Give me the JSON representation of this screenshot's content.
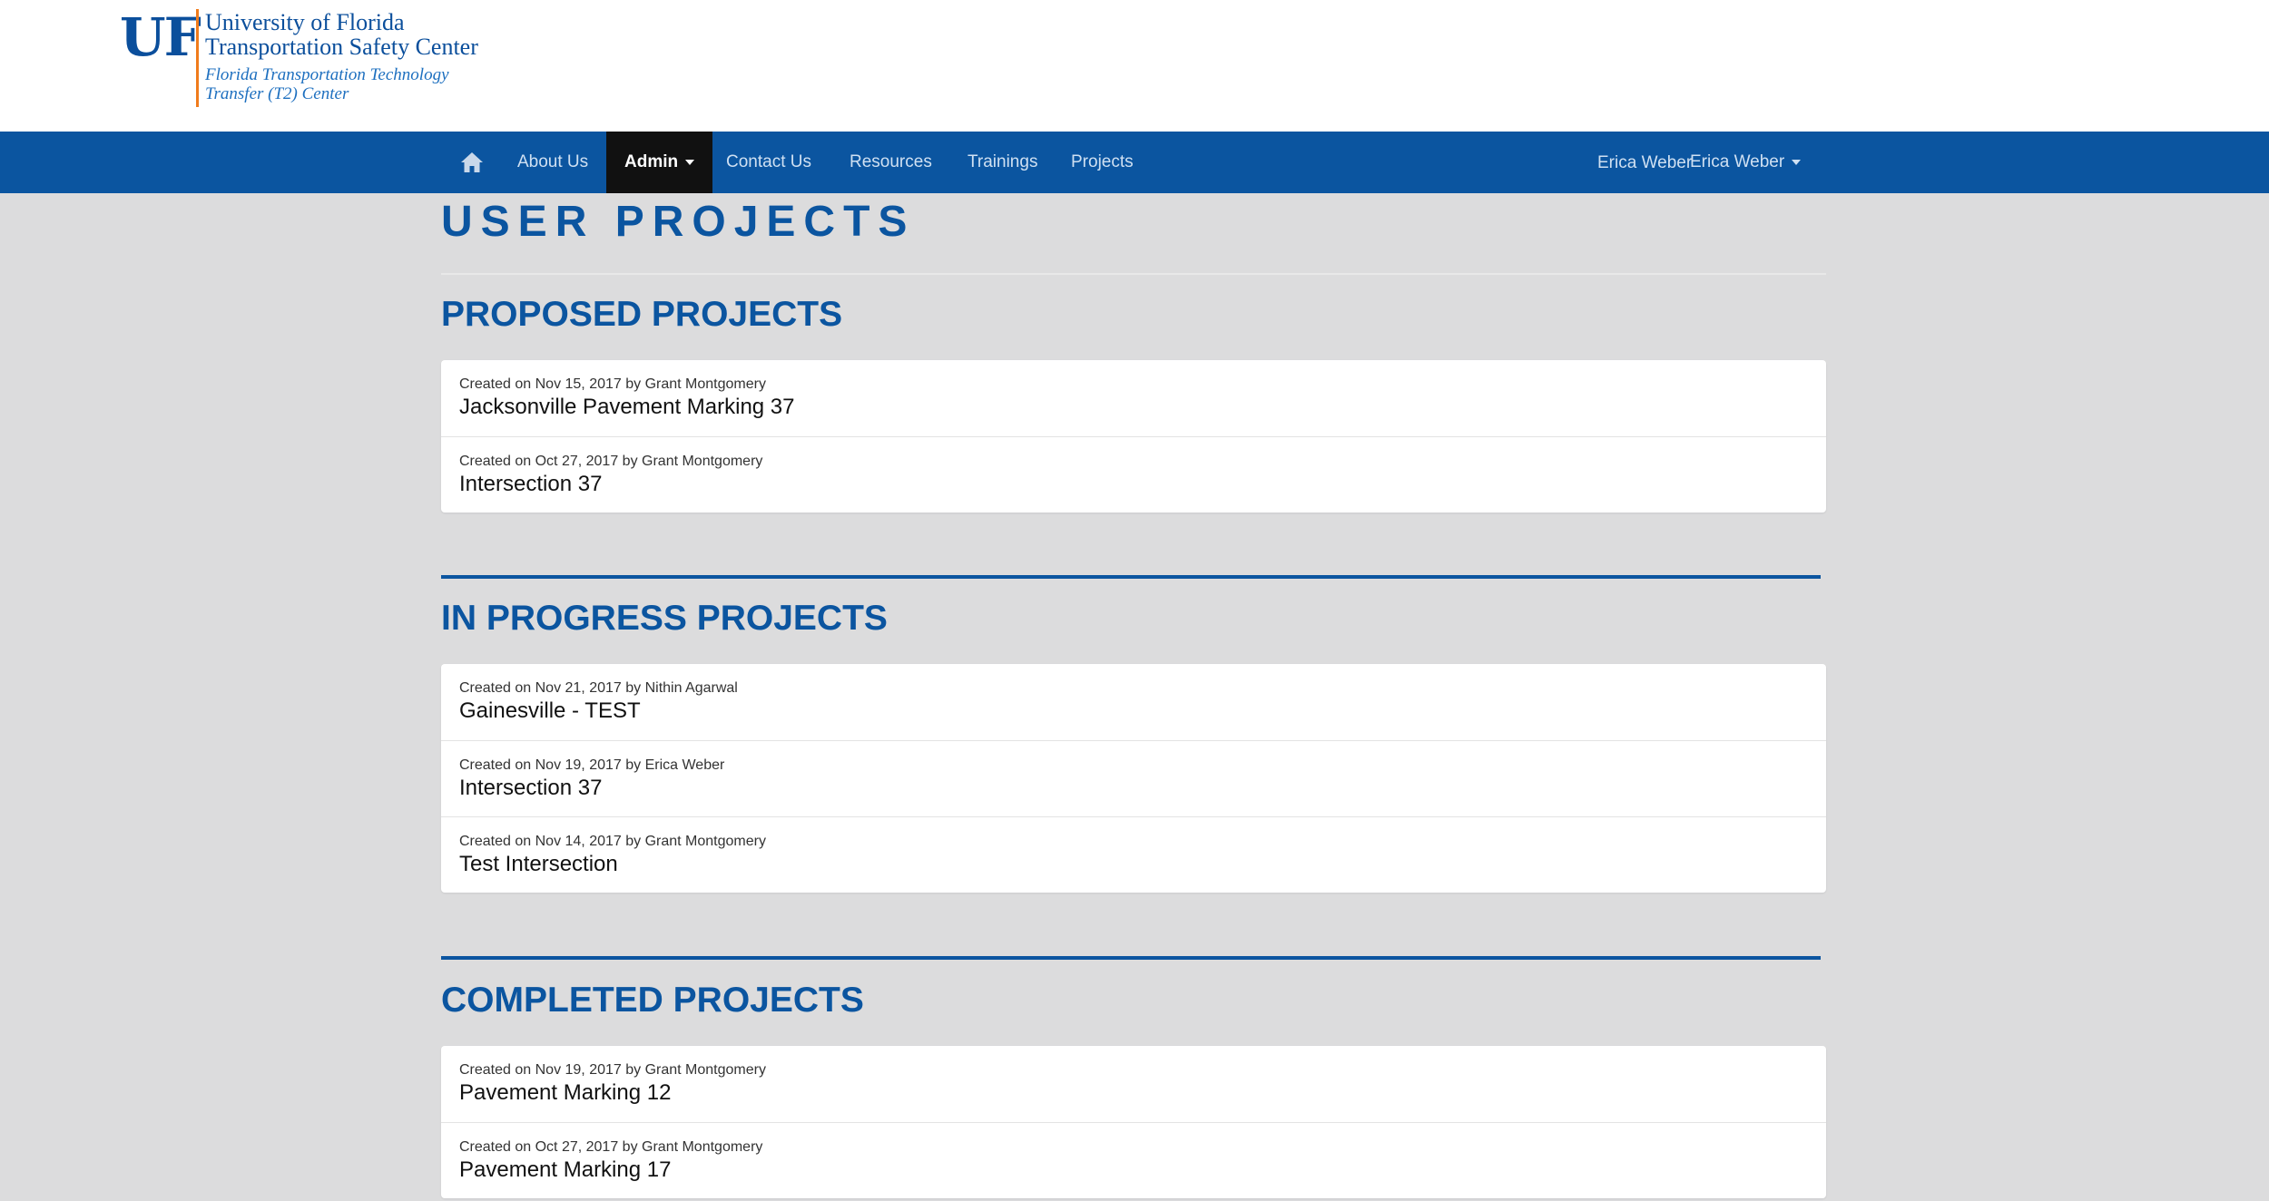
{
  "logo": {
    "mark": "UF",
    "line1": "University of Florida",
    "line2": "Transportation Safety Center",
    "line3": "Florida Transportation Technology",
    "line4": "Transfer (T2) Center",
    "brand_color": "#0b4f9c",
    "accent_color": "#f07c1c"
  },
  "nav": {
    "home_icon": "home-icon",
    "items": [
      {
        "label": "About Us"
      },
      {
        "label": "Admin"
      },
      {
        "label": "Contact Us"
      },
      {
        "label": "Resources"
      },
      {
        "label": "Trainings"
      },
      {
        "label": "Projects"
      }
    ],
    "user_label": "Erica Weber",
    "user_menu": "Erica Weber",
    "bar_color": "#0b55a0"
  },
  "page": {
    "title": "USER PROJECTS"
  },
  "sections": {
    "proposed": {
      "title": "PROPOSED PROJECTS",
      "rows": [
        {
          "meta": "Created on Nov 15, 2017 by Grant Montgomery",
          "title": "Jacksonville Pavement Marking 37"
        },
        {
          "meta": "Created on Oct 27, 2017 by Grant Montgomery",
          "title": "Intersection 37"
        }
      ]
    },
    "in_progress": {
      "title": "IN PROGRESS PROJECTS",
      "rows": [
        {
          "meta": "Created on Nov 21, 2017 by Nithin Agarwal",
          "title": "Gainesville - TEST"
        },
        {
          "meta": "Created on Nov 19, 2017 by Erica Weber",
          "title": "Intersection 37"
        },
        {
          "meta": "Created on Nov 14, 2017 by Grant Montgomery",
          "title": "Test Intersection"
        }
      ]
    },
    "completed": {
      "title": "COMPLETED PROJECTS",
      "rows": [
        {
          "meta": "Created on Nov 19, 2017 by Grant Montgomery",
          "title": "Pavement Marking 12"
        },
        {
          "meta": "Created on Oct 27, 2017 by Grant Montgomery",
          "title": "Pavement Marking 17"
        }
      ]
    }
  }
}
